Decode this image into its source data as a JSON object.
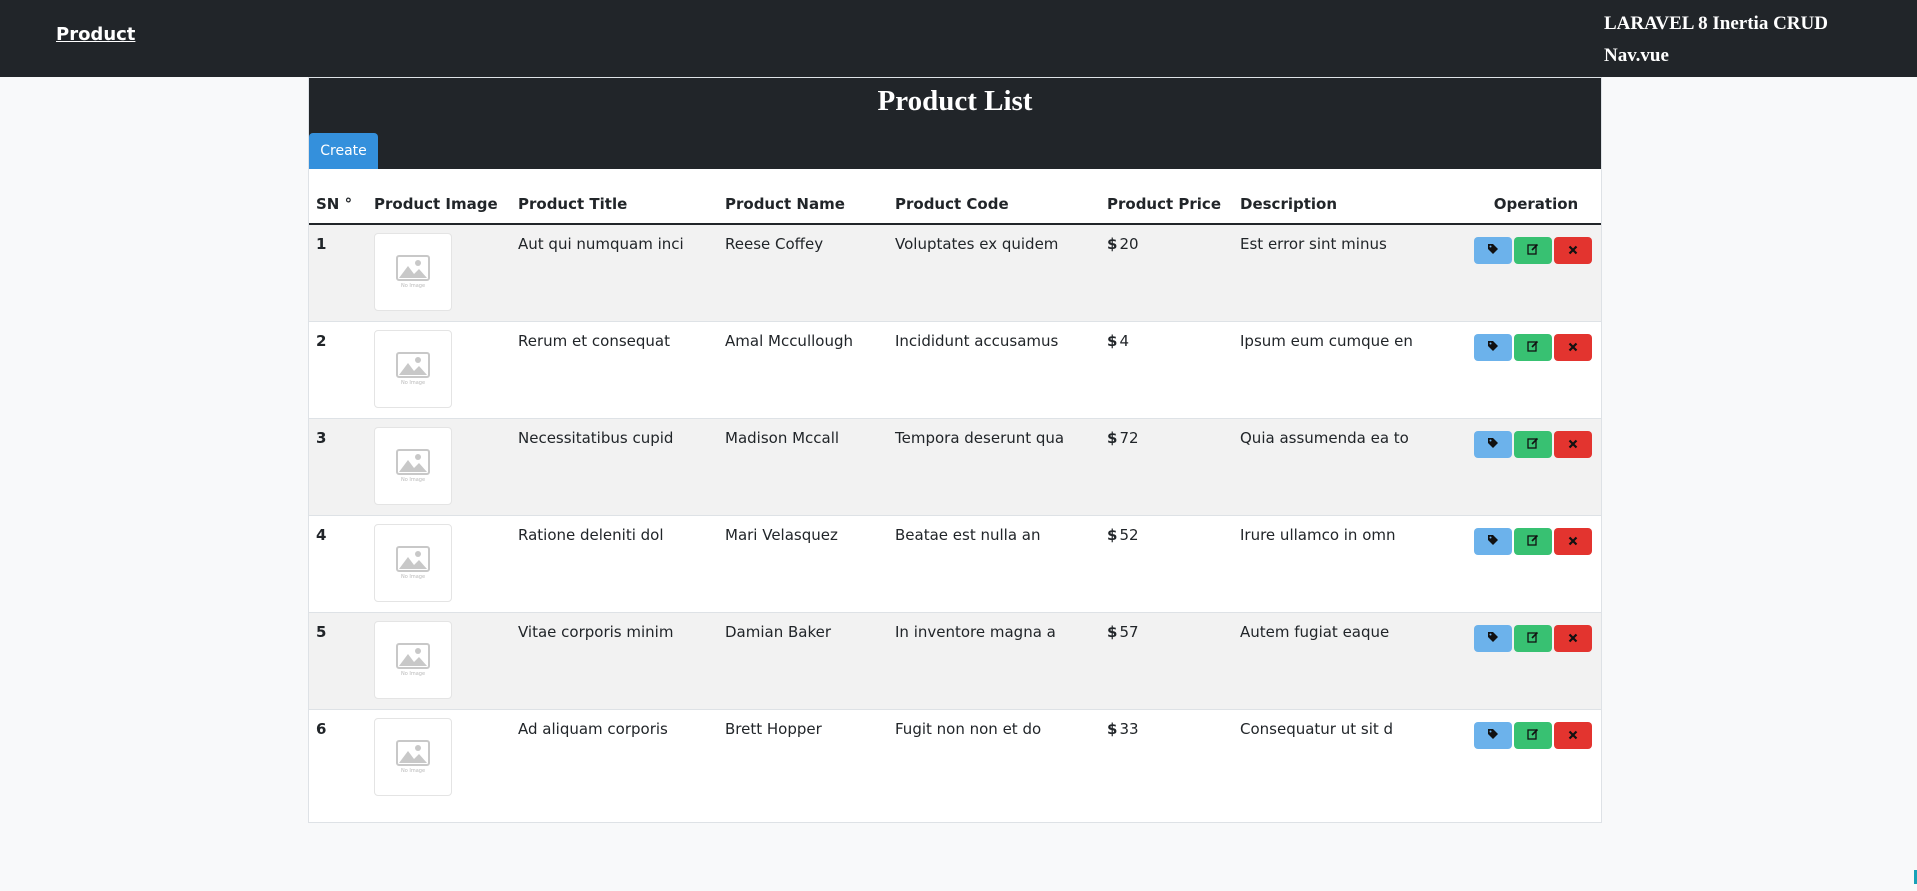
{
  "nav": {
    "brand": "Product",
    "title_line1": "LARAVEL 8 Inertia CRUD",
    "title_line2": "Nav.vue"
  },
  "card": {
    "title": "Product List",
    "create_label": "Create"
  },
  "table": {
    "headers": [
      "SN °",
      "Product Image",
      "Product Title",
      "Product Name",
      "Product Code",
      "Product Price",
      "Description",
      "Operation"
    ],
    "image_placeholder": "No Image",
    "currency": "$",
    "rows": [
      {
        "sn": "1",
        "title": "Aut qui numquam inci",
        "name": "Reese Coffey",
        "code": "Voluptates ex quidem",
        "price": "20",
        "description": "Est error sint minus"
      },
      {
        "sn": "2",
        "title": "Rerum et consequat",
        "name": "Amal Mccullough",
        "code": "Incididunt accusamus",
        "price": "4",
        "description": "Ipsum eum cumque en"
      },
      {
        "sn": "3",
        "title": "Necessitatibus cupid",
        "name": "Madison Mccall",
        "code": "Tempora deserunt qua",
        "price": "72",
        "description": "Quia assumenda ea to"
      },
      {
        "sn": "4",
        "title": "Ratione deleniti dol",
        "name": "Mari Velasquez",
        "code": "Beatae est nulla an",
        "price": "52",
        "description": "Irure ullamco in omn"
      },
      {
        "sn": "5",
        "title": "Vitae corporis minim",
        "name": "Damian Baker",
        "code": "In inventore magna a",
        "price": "57",
        "description": "Autem fugiat eaque"
      },
      {
        "sn": "6",
        "title": "Ad aliquam corporis",
        "name": "Brett Hopper",
        "code": "Fugit non non et do",
        "price": "33",
        "description": "Consequatur ut sit d"
      }
    ]
  },
  "icons": {
    "tag": "tag-icon",
    "edit": "edit-icon",
    "delete": "close-icon",
    "image": "image-placeholder-icon"
  },
  "colors": {
    "navbar": "#212529",
    "create_button": "#3490dc",
    "tag_button": "#6cb2eb",
    "edit_button": "#38c172",
    "delete_button": "#e3342f"
  }
}
